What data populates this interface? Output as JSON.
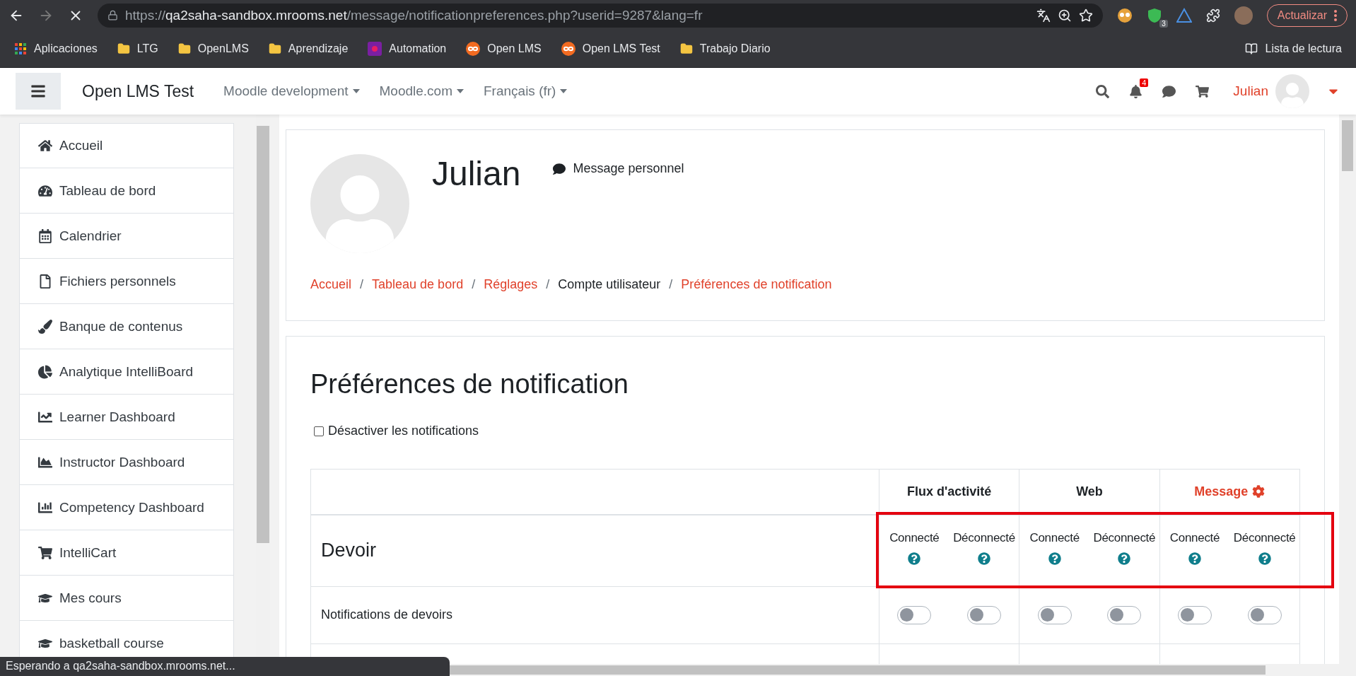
{
  "browser": {
    "url_scheme": "https://",
    "url_host": "qa2saha-sandbox.mrooms.net",
    "url_path": "/message/notificationpreferences.php?userid=9287&lang=fr",
    "extension_badge": "3",
    "update_button": "Actualizar",
    "bookmarks": [
      {
        "label": "Aplicaciones",
        "kind": "apps"
      },
      {
        "label": "LTG",
        "kind": "folder"
      },
      {
        "label": "OpenLMS",
        "kind": "folder"
      },
      {
        "label": "Aprendizaje",
        "kind": "folder"
      },
      {
        "label": "Automation",
        "kind": "app"
      },
      {
        "label": "Open LMS",
        "kind": "site"
      },
      {
        "label": "Open LMS Test",
        "kind": "site"
      },
      {
        "label": "Trabajo Diario",
        "kind": "folder"
      }
    ],
    "reading_list": "Lista de lectura"
  },
  "navbar": {
    "site_name": "Open LMS Test",
    "menus": [
      "Moodle development",
      "Moodle.com",
      "Français (fr)"
    ],
    "notification_count": "4",
    "user_name": "Julian"
  },
  "sidebar": {
    "items": [
      {
        "label": "Accueil"
      },
      {
        "label": "Tableau de bord"
      },
      {
        "label": "Calendrier"
      },
      {
        "label": "Fichiers personnels"
      },
      {
        "label": "Banque de contenus"
      },
      {
        "label": "Analytique IntelliBoard"
      },
      {
        "label": "Learner Dashboard"
      },
      {
        "label": "Instructor Dashboard"
      },
      {
        "label": "Competency Dashboard"
      },
      {
        "label": "IntelliCart"
      },
      {
        "label": "Mes cours"
      },
      {
        "label": "basketball course"
      }
    ]
  },
  "profile": {
    "name": "Julian",
    "message_link": "Message personnel",
    "breadcrumb": [
      {
        "label": "Accueil",
        "link": true
      },
      {
        "label": "/",
        "kind": "separator"
      },
      {
        "label": "Tableau de bord",
        "link": true
      },
      {
        "label": "/",
        "kind": "separator"
      },
      {
        "label": "Réglages",
        "link": true
      },
      {
        "label": "/",
        "kind": "separator"
      },
      {
        "label": "Compte utilisateur",
        "link": false
      },
      {
        "label": "/",
        "kind": "separator"
      },
      {
        "label": "Préférences de notification",
        "link": true
      }
    ]
  },
  "preferences": {
    "title": "Préférences de notification",
    "disable_notifications": {
      "label": "Désactiver les notifications",
      "checked": false
    },
    "table": {
      "columns": [
        {
          "label": "Flux d'activité",
          "kind": "plain"
        },
        {
          "label": "Web",
          "kind": "plain"
        },
        {
          "label": "Message",
          "kind": "configurable"
        }
      ],
      "section": {
        "title": "Devoir",
        "states": [
          "Connecté",
          "Déconnecté",
          "Connecté",
          "Déconnecté",
          "Connecté",
          "Déconnecté"
        ]
      },
      "rows": [
        {
          "label": "Notifications de devoirs",
          "toggles": [
            {
              "on": false
            },
            {
              "on": false
            },
            {
              "on": false
            },
            {
              "on": false
            },
            {
              "on": false
            },
            {
              "on": false
            }
          ]
        }
      ]
    },
    "highlighted": true
  },
  "status_bar": "Esperando a qa2saha-sandbox.mrooms.net..."
}
